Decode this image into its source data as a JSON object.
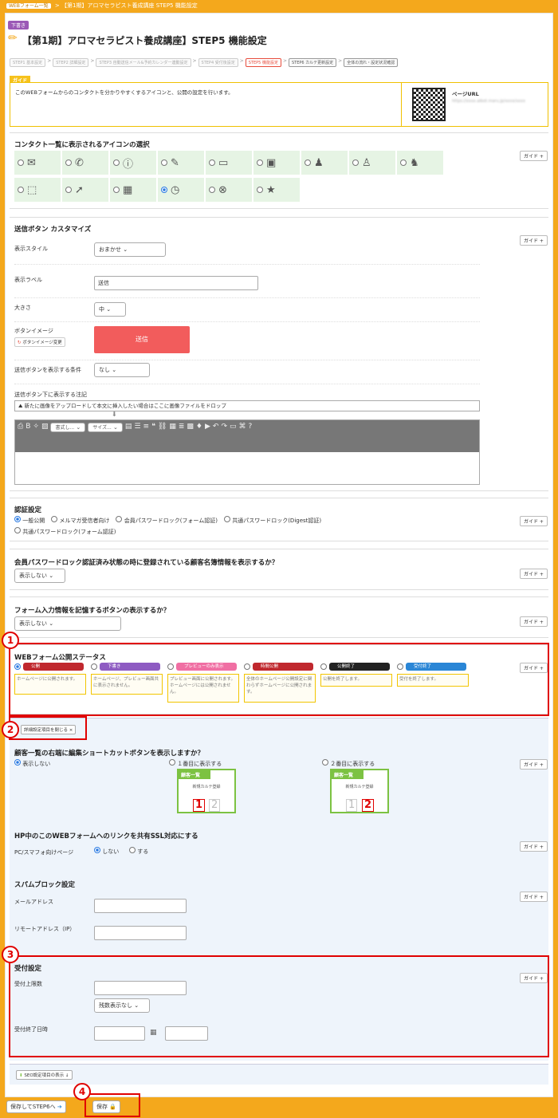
{
  "breadcrumb": {
    "root": "WEBフォーム一覧",
    "sep": ">",
    "current": "【第1期】アロマセラピスト養成講座 STEP5 機能設定"
  },
  "header": {
    "status_badge": "下書き",
    "title": "【第1期】アロマセラピスト養成講座】STEP5 機能設定"
  },
  "steps": [
    {
      "label": "STEP1 基本設定"
    },
    {
      "label": "STEP2 詳細設定"
    },
    {
      "label": "STEP3 自動送信メール&予約カレンダー連動設定"
    },
    {
      "label": "STEP4 受付後設定"
    },
    {
      "label": "STEP5 機能設定"
    },
    {
      "label": "STEP6 カルテ更新設定"
    },
    {
      "label": "全体の流れ・設定状況確認"
    }
  ],
  "step_sep": ">",
  "guide": {
    "tag": "ガイド",
    "text": "このWEBフォームからのコンタクトを分かりやすくするアイコンと、公開の設定を行います。",
    "url_label": "ページURL",
    "url_value": "https://xxxx.aibot.maru.jp/xxxx/xxxx"
  },
  "guide_btn": "ガイド +",
  "icon_section": {
    "title": "コンタクト一覧に表示されるアイコンの選択",
    "icons_row1": [
      "✉",
      "✆",
      "ⓘ",
      "✎",
      "▭",
      "▣",
      "♟",
      "♙",
      "♞"
    ],
    "icons_row2": [
      "⬚",
      "➚",
      "▦",
      "◷",
      "⊗",
      "★"
    ]
  },
  "submit_section": {
    "title": "送信ボタン カスタマイズ",
    "style_label": "表示スタイル",
    "style_value": "おまかせ",
    "label_label": "表示ラベル",
    "label_value": "送信",
    "size_label": "大きさ",
    "size_value": "中",
    "image_label": "ボタンイメージ",
    "image_btn": "ボタンイメージ変更",
    "preview": "送信",
    "cond_label": "送信ボタンを表示する条件",
    "cond_value": "なし",
    "note_label": "送信ボタン下に表示する注記",
    "drop_text": "新たに画像をアップロードして本文に挿入したい場合はここに画像ファイルをドロップ",
    "toolbar_format": "書式し...",
    "toolbar_size": "サイズ..."
  },
  "auth_section": {
    "title": "認証設定",
    "options": [
      "一般公開",
      "メルマガ受信者向け",
      "会員パスワードロック(フォーム認証)",
      "共通パスワードロック(Digest認証)",
      "共通パスワードロック(フォーム認証)"
    ]
  },
  "member_section": {
    "title": "会員パスワードロック認証済み状態の時に登録されている顧客名簿情報を表示するか？",
    "value": "表示しない"
  },
  "remember_section": {
    "title": "フォーム入力情報を記憶するボタンの表示するか？",
    "value": "表示しない"
  },
  "status_section": {
    "title": "WEBフォーム公開ステータス",
    "items": [
      {
        "label": "公開",
        "color": "#c0282e",
        "desc": "ホームページに公開されます。"
      },
      {
        "label": "下書き",
        "color": "#8e5bc2",
        "desc": "ホームページ、プレビュー画面共に表示されません。"
      },
      {
        "label": "プレビューのみ表示",
        "color": "#f06fa3",
        "desc": "プレビュー画面に公開されます。ホームページには公開されません。"
      },
      {
        "label": "時間公開",
        "color": "#c0282e",
        "desc": "全体のホームページ公開設定に関わらずホームページに公開されます。"
      },
      {
        "label": "公開終了",
        "color": "#222222",
        "desc": "公開を終了します。"
      },
      {
        "label": "受付終了",
        "color": "#2a86d6",
        "desc": "受付を終了します。"
      }
    ]
  },
  "detail_toggle": "詳細設定項目を閉じる ×",
  "shortcut_section": {
    "title": "顧客一覧の右端に編集ショートカットボタンを表示しますか？",
    "options": [
      "表示しない",
      "１番目に表示する",
      "２番目に表示する"
    ],
    "preview_head": "顧客一覧",
    "preview_cell": "新規カルテ登録",
    "n1": "1",
    "n2": "2"
  },
  "ssl_section": {
    "title": "HP中のこのWEBフォームへのリンクを共有SSL対応にする",
    "row_label": "PC/スマフォ向けページ",
    "options": [
      "しない",
      "する"
    ]
  },
  "spam_section": {
    "title": "スパムブロック設定",
    "mail_label": "メールアドレス",
    "remote_label": "リモートアドレス（IP）"
  },
  "reception_section": {
    "title": "受付設定",
    "limit_label": "受付上限数",
    "remain_value": "残数表示なし",
    "end_label": "受付終了日時"
  },
  "seo_toggle": "SEO設定項目の表示 ↓",
  "footer": {
    "save_next": "保存してSTEP6へ",
    "save": "保存"
  },
  "markers": [
    "1",
    "2",
    "3",
    "4"
  ]
}
